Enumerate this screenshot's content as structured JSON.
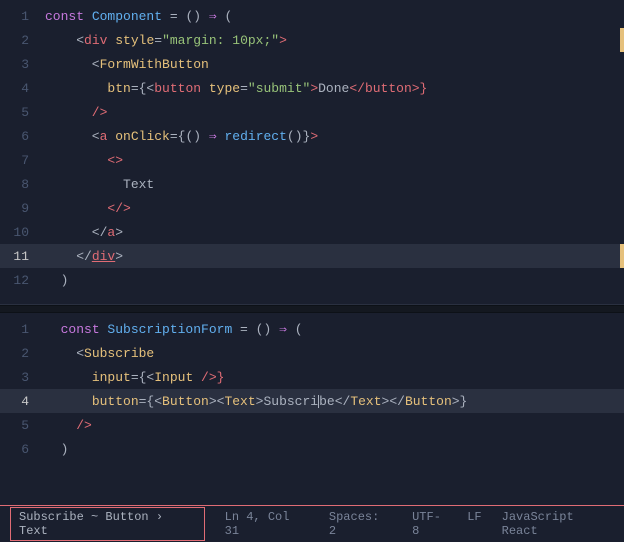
{
  "editor": {
    "background": "#1a1f2e",
    "top_section": {
      "lines": [
        {
          "num": 1,
          "tokens": [
            {
              "t": "const ",
              "c": "kw"
            },
            {
              "t": "Component",
              "c": "fn"
            },
            {
              "t": " = ",
              "c": "op"
            },
            {
              "t": "() ",
              "c": "plain"
            },
            {
              "t": "⇒",
              "c": "arrow"
            },
            {
              "t": " (",
              "c": "plain"
            }
          ]
        },
        {
          "num": 2,
          "tokens": [
            {
              "t": "    <",
              "c": "tag"
            },
            {
              "t": "div",
              "c": "tag"
            },
            {
              "t": " ",
              "c": "plain"
            },
            {
              "t": "style",
              "c": "attr"
            },
            {
              "t": "=\"",
              "c": "str"
            },
            {
              "t": "margin: 10px;",
              "c": "str"
            },
            {
              "t": "\"",
              "c": "str"
            },
            {
              "t": ">",
              "c": "tag"
            }
          ],
          "gutter": true
        },
        {
          "num": 3,
          "tokens": [
            {
              "t": "      <",
              "c": "tag"
            },
            {
              "t": "FormWithButton",
              "c": "component-name"
            }
          ]
        },
        {
          "num": 4,
          "tokens": [
            {
              "t": "        ",
              "c": "plain"
            },
            {
              "t": "btn",
              "c": "attr"
            },
            {
              "t": "={<",
              "c": "jsx-expr"
            },
            {
              "t": "button",
              "c": "tag"
            },
            {
              "t": " ",
              "c": "plain"
            },
            {
              "t": "type",
              "c": "attr"
            },
            {
              "t": "=\"",
              "c": "str"
            },
            {
              "t": "submit",
              "c": "str"
            },
            {
              "t": "\"",
              "c": "str"
            },
            {
              "t": ">",
              "c": "tag"
            },
            {
              "t": "Done",
              "c": "plain"
            },
            {
              "t": "</",
              "c": "tag"
            },
            {
              "t": "button",
              "c": "tag"
            },
            {
              "t": ">}",
              "c": "tag"
            }
          ]
        },
        {
          "num": 5,
          "tokens": [
            {
              "t": "      />",
              "c": "tag"
            }
          ]
        },
        {
          "num": 6,
          "tokens": [
            {
              "t": "      <",
              "c": "tag"
            },
            {
              "t": "a",
              "c": "tag"
            },
            {
              "t": " ",
              "c": "plain"
            },
            {
              "t": "onClick",
              "c": "attr"
            },
            {
              "t": "={",
              "c": "jsx-expr"
            },
            {
              "t": "() ",
              "c": "plain"
            },
            {
              "t": "⇒",
              "c": "arrow"
            },
            {
              "t": " ",
              "c": "plain"
            },
            {
              "t": "redirect",
              "c": "redirect"
            },
            {
              "t": "()}",
              "c": "plain"
            },
            {
              "t": ">",
              "c": "tag"
            }
          ]
        },
        {
          "num": 7,
          "tokens": [
            {
              "t": "        <>",
              "c": "tag"
            }
          ]
        },
        {
          "num": 8,
          "tokens": [
            {
              "t": "          Text",
              "c": "plain"
            }
          ]
        },
        {
          "num": 9,
          "tokens": [
            {
              "t": "        </>",
              "c": "tag"
            }
          ]
        },
        {
          "num": 10,
          "tokens": [
            {
              "t": "      </",
              "c": "tag"
            },
            {
              "t": "a",
              "c": "tag"
            },
            {
              "t": ">",
              "c": "tag"
            }
          ]
        },
        {
          "num": 11,
          "tokens": [
            {
              "t": "    </",
              "c": "tag"
            },
            {
              "t": "div",
              "c": "tag"
            },
            {
              "t": ">",
              "c": "tag"
            }
          ],
          "highlight": true,
          "gutter": true
        },
        {
          "num": 12,
          "tokens": [
            {
              "t": "  )",
              "c": "plain"
            }
          ]
        }
      ]
    },
    "bottom_section": {
      "lines": [
        {
          "num": 1,
          "tokens": [
            {
              "t": "  ",
              "c": "plain"
            },
            {
              "t": "const ",
              "c": "kw"
            },
            {
              "t": "SubscriptionForm",
              "c": "fn"
            },
            {
              "t": " = ",
              "c": "op"
            },
            {
              "t": "() ",
              "c": "plain"
            },
            {
              "t": "⇒",
              "c": "arrow"
            },
            {
              "t": " (",
              "c": "plain"
            }
          ]
        },
        {
          "num": 2,
          "tokens": [
            {
              "t": "    <",
              "c": "tag"
            },
            {
              "t": "Subscribe",
              "c": "component-name"
            }
          ]
        },
        {
          "num": 3,
          "tokens": [
            {
              "t": "      ",
              "c": "plain"
            },
            {
              "t": "input",
              "c": "attr"
            },
            {
              "t": "={<",
              "c": "jsx-expr"
            },
            {
              "t": "Input",
              "c": "component-name"
            },
            {
              "t": " />}",
              "c": "tag"
            }
          ]
        },
        {
          "num": 4,
          "tokens": [
            {
              "t": "      ",
              "c": "plain"
            },
            {
              "t": "button",
              "c": "attr"
            },
            {
              "t": "={<",
              "c": "jsx-expr"
            },
            {
              "t": "Button",
              "c": "component-name"
            },
            {
              "t": "><",
              "c": "tag"
            },
            {
              "t": "Text",
              "c": "component-name"
            },
            {
              "t": ">Subscri",
              "c": "plain"
            },
            {
              "t": "be",
              "c": "plain"
            },
            {
              "t": "</",
              "c": "tag"
            },
            {
              "t": "Text",
              "c": "component-name"
            },
            {
              "t": "></",
              "c": "tag"
            },
            {
              "t": "Button",
              "c": "component-name"
            },
            {
              "t": ">}",
              "c": "tag"
            }
          ],
          "highlight": true
        },
        {
          "num": 5,
          "tokens": [
            {
              "t": "    />",
              "c": "tag"
            }
          ]
        },
        {
          "num": 6,
          "tokens": [
            {
              "t": "  )",
              "c": "plain"
            }
          ]
        }
      ]
    },
    "status_bar": {
      "breadcrumb": "Subscribe ~ Button › Text",
      "ln": "Ln 4, Col 31",
      "spaces": "Spaces: 2",
      "encoding": "UTF-8",
      "line_ending": "LF",
      "language": "JavaScript React"
    }
  }
}
